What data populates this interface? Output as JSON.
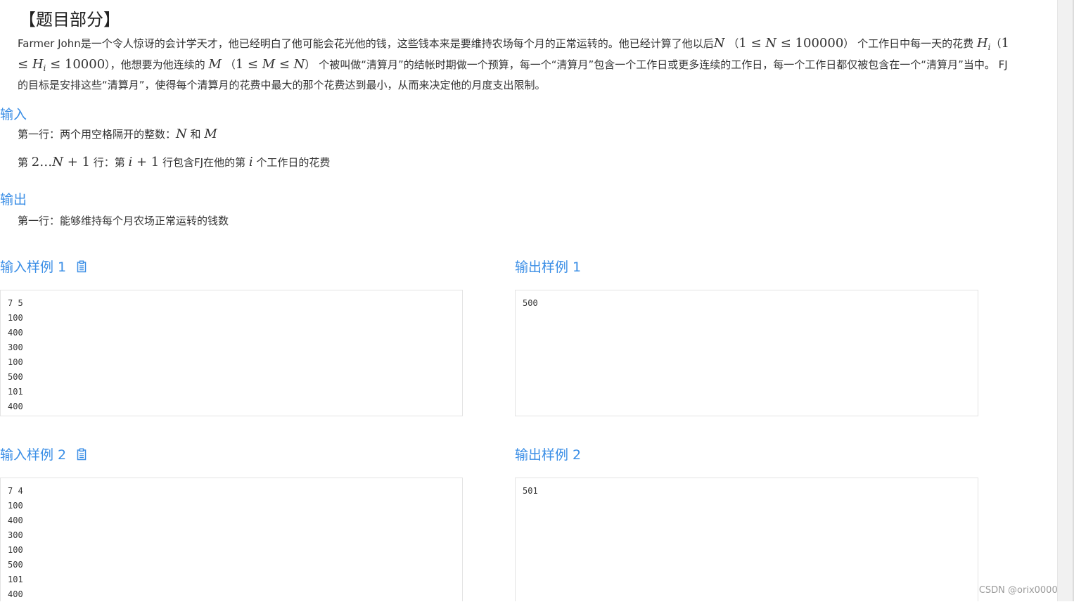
{
  "header": {
    "title": "【题目部分】"
  },
  "problem": {
    "t1": "Farmer John是一个令人惊讶的会计学天才，他已经明白了他可能会花光他的钱，这些钱本来是要维持农场每个月的正常运转的。他已经计算了他以后",
    "N": "N",
    "range_n_open": "（",
    "range_n_math1": "1 ≤ ",
    "range_n_var": "N",
    "range_n_math2": " ≤ 100000",
    "range_n_close": "）",
    "t2": "个工作日中每一天的花费",
    "H": "H",
    "H_sub": "i",
    "range_h_open": "（",
    "range_h_math1": "1 ≤ ",
    "range_h_var": "H",
    "range_h_sub": "i",
    "range_h_math2": " ≤ 10000",
    "range_h_close": "），",
    "t3": "他想要为他连续的",
    "M": "M",
    "range_m_open": "（",
    "range_m_math1": "1 ≤ ",
    "range_m_var": "M",
    "range_m_math2": " ≤ ",
    "range_m_var2": "N",
    "range_m_close": "）",
    "t4": "个被叫做“清算月”的结帐时期做一个预算，每一个“清算月”包含一个工作日或更多连续的工作日，每一个工作日都仅被包含在一个“清算月”当中。 FJ的目标是安排这些“清算月”，使得每个清算月的花费中最大的那个花费达到最小，从而来决定他的月度支出限制。"
  },
  "input_section": {
    "title": "输入",
    "line1_text": "第一行：两个用空格隔开的整数：",
    "line1_N": "N",
    "line1_and": " 和 ",
    "line1_M": "M",
    "line2_a": "第 ",
    "line2_math": "2…",
    "line2_N": "N",
    "line2_plus": " + 1",
    "line2_b": " 行：第 ",
    "line2_i": "i",
    "line2_plus2": " + 1",
    "line2_c": " 行包含FJ在他的第 ",
    "line2_i2": "i",
    "line2_d": " 个工作日的花费"
  },
  "output_section": {
    "title": "输出",
    "line1": "第一行：能够维持每个月农场正常运转的钱数"
  },
  "samples": {
    "in1_title": "输入样例 1",
    "out1_title": "输出样例 1",
    "in1": "7 5\n100\n400\n300\n100\n500\n101\n400",
    "out1": "500",
    "in2_title": "输入样例 2",
    "out2_title": "输出样例 2",
    "in2": "7 4\n100\n400\n300\n100\n500\n101\n400",
    "out2": "501"
  },
  "watermark": "CSDN @orix00000",
  "icons": {
    "copy": "clipboard-icon"
  },
  "colors": {
    "accent": "#3a8ee6",
    "text": "#333333"
  }
}
